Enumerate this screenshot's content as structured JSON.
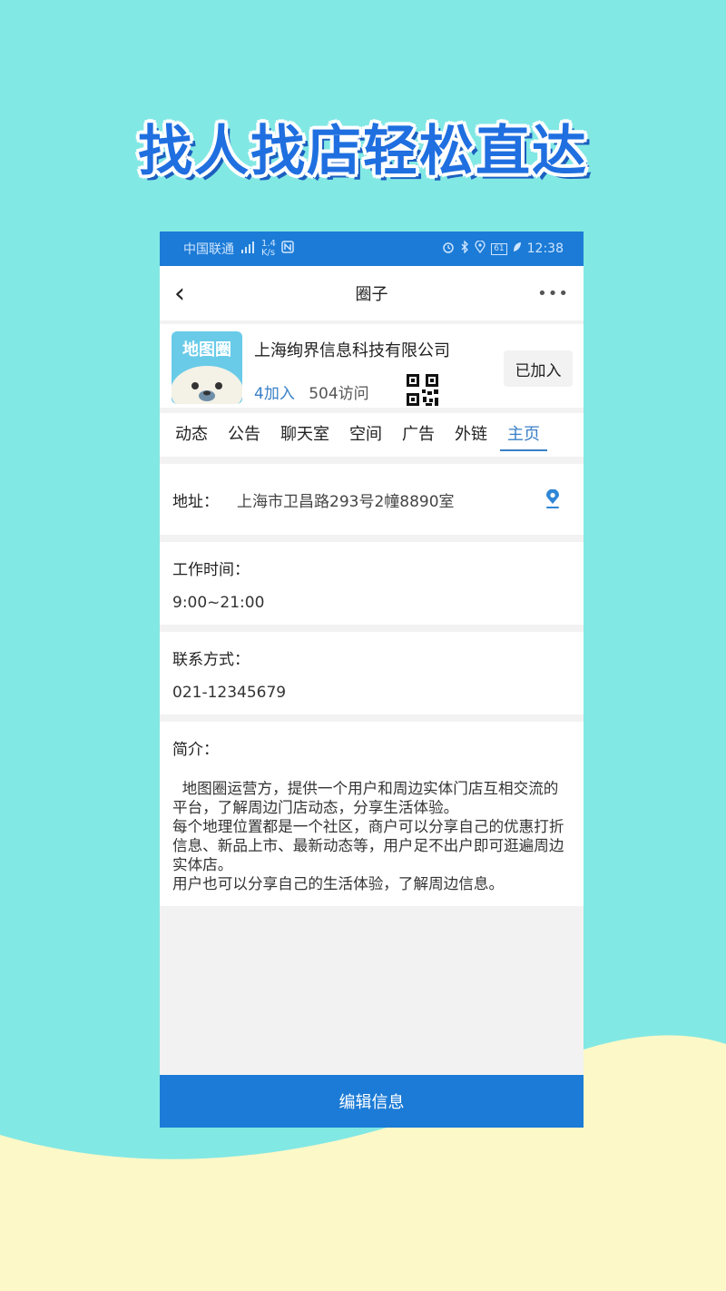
{
  "headline": "找人找店轻松直达",
  "status_bar": {
    "carrier": "中国联通",
    "net_speed_value": "1.4",
    "net_speed_unit": "K/s",
    "battery": "61",
    "time": "12:38"
  },
  "nav": {
    "back_glyph": "‹",
    "title": "圈子",
    "more_glyph": "•••"
  },
  "circle": {
    "logo_text": "地图圈",
    "company_name": "上海绚界信息科技有限公司",
    "joined": "4加入",
    "visits": "504访问",
    "join_button": "已加入"
  },
  "tabs": [
    {
      "label": "动态",
      "active": false
    },
    {
      "label": "公告",
      "active": false
    },
    {
      "label": "聊天室",
      "active": false
    },
    {
      "label": "空间",
      "active": false
    },
    {
      "label": "广告",
      "active": false
    },
    {
      "label": "外链",
      "active": false
    },
    {
      "label": "主页",
      "active": true
    }
  ],
  "details": {
    "address_label": "地址：",
    "address_value": "上海市卫昌路293号2幢8890室",
    "hours_label": "工作时间：",
    "hours_value": "9:00~21:00",
    "contact_label": "联系方式：",
    "contact_value": "021-12345679",
    "intro_label": "简介：",
    "intro_text": "  地图圈运营方，提供一个用户和周边实体门店互相交流的平台，了解周边门店动态，分享生活体验。\n每个地理位置都是一个社区，商户可以分享自己的优惠打折信息、新品上市、最新动态等，用户足不出户即可逛遍周边实体店。\n用户也可以分享自己的生活体验，了解周边信息。"
  },
  "edit_button": "编辑信息",
  "colors": {
    "background": "#82e8e4",
    "wave": "#fdf8c8",
    "accent_blue": "#1c7bd6",
    "link_blue": "#3a80c7"
  }
}
